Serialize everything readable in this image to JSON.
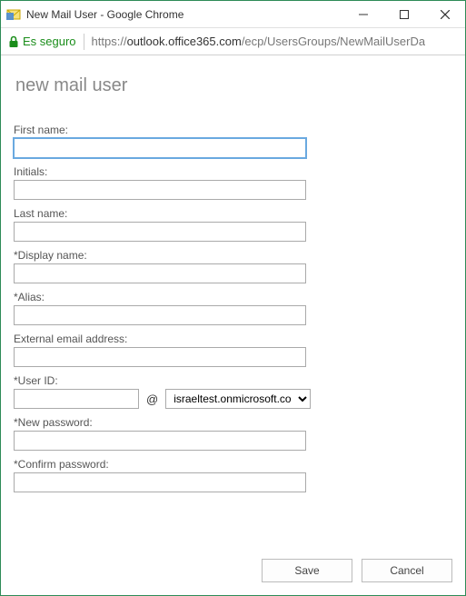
{
  "window": {
    "title": "New Mail User - Google Chrome"
  },
  "address": {
    "secure_label": "Es seguro",
    "url_prefix": "https://",
    "url_domain": "outlook.office365.com",
    "url_path": "/ecp/UsersGroups/NewMailUserDa"
  },
  "page": {
    "heading": "new mail user"
  },
  "form": {
    "first_name_label": "First name:",
    "first_name_value": "",
    "initials_label": "Initials:",
    "initials_value": "",
    "last_name_label": "Last name:",
    "last_name_value": "",
    "display_name_label": "*Display name:",
    "display_name_value": "",
    "alias_label": "*Alias:",
    "alias_value": "",
    "external_email_label": "External email address:",
    "external_email_value": "",
    "user_id_label": "*User ID:",
    "user_id_value": "",
    "at_symbol": "@",
    "domain_selected": "israeltest.onmicrosoft.co",
    "new_password_label": "*New password:",
    "new_password_value": "",
    "confirm_password_label": "*Confirm password:",
    "confirm_password_value": ""
  },
  "buttons": {
    "save": "Save",
    "cancel": "Cancel"
  }
}
